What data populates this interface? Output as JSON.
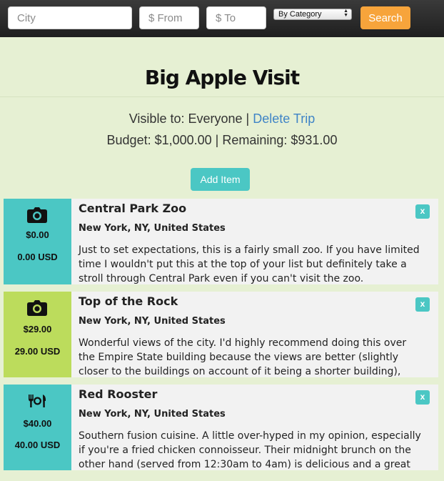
{
  "search": {
    "city_placeholder": "City",
    "from_placeholder": "$ From",
    "to_placeholder": "$ To",
    "category_selected": "By Category",
    "search_label": "Search"
  },
  "trip": {
    "title": "Big Apple Visit",
    "visible_label": "Visible to: Everyone",
    "separator": " | ",
    "delete_label": "Delete Trip",
    "budget_text": "Budget: $1,000.00 | Remaining: $931.00",
    "add_item_label": "Add Item"
  },
  "items": [
    {
      "icon": "camera-icon",
      "color": "#4bc7c4",
      "price": "$0.00",
      "price_usd": "0.00 USD",
      "title": "Central Park Zoo",
      "location": "New York, NY, United States",
      "description": "Just to set expectations, this is a fairly small zoo. If you have limited time I wouldn't put this at the top of your list but definitely take a stroll through Central Park even if you can't visit the zoo.",
      "close_label": "x"
    },
    {
      "icon": "camera-icon",
      "color": "#bcdc5c",
      "price": "$29.00",
      "price_usd": "29.00 USD",
      "title": "Top of the Rock",
      "location": "New York, NY, United States",
      "description": "Wonderful views of the city. I'd highly recommend doing this over the Empire State building because the views are better (slightly closer to the buildings on account of it being a shorter building), and it has a",
      "close_label": "x"
    },
    {
      "icon": "restaurant-icon",
      "color": "#4bc7c4",
      "price": "$40.00",
      "price_usd": "40.00 USD",
      "title": "Red Rooster",
      "location": "New York, NY, United States",
      "description": "Southern fusion cuisine. A little over-hyped in my opinion, especially if you're a fried chicken connoisseur. Their midnight brunch on the other hand (served from 12:30am to 4am) is delicious and a great",
      "close_label": "x"
    }
  ]
}
